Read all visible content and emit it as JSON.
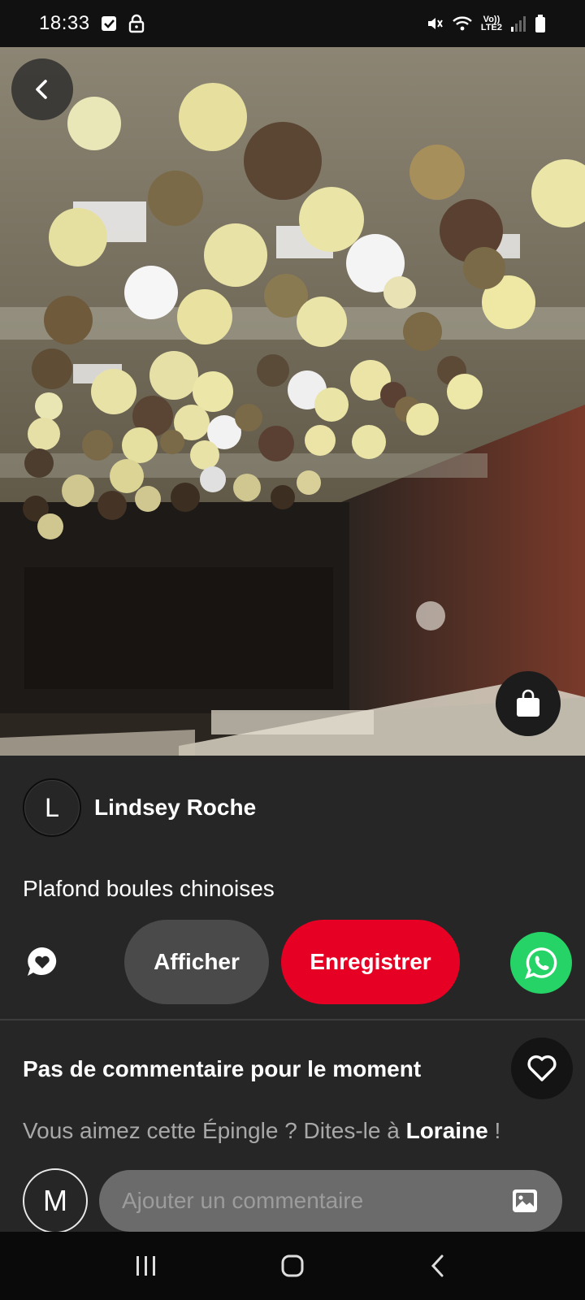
{
  "status_bar": {
    "time": "18:33",
    "network_label_top": "Vo))",
    "network_label_bottom": "LTE2",
    "icons": [
      "checkbox-icon",
      "lock-icon",
      "mute-icon",
      "wifi-icon",
      "signal-icon",
      "battery-icon"
    ]
  },
  "hero": {
    "icons": {
      "back": "chevron-left-icon",
      "shop": "shopping-bag-icon"
    }
  },
  "author": {
    "initial": "L",
    "name": "Lindsey Roche"
  },
  "pin": {
    "title": "Plafond boules chinoises"
  },
  "actions": {
    "view_label": "Afficher",
    "save_label": "Enregistrer",
    "save_color": "#e60023",
    "whatsapp_color": "#25d366",
    "icons": [
      "comment-heart-icon",
      "whatsapp-icon"
    ]
  },
  "comments": {
    "empty_title": "Pas de commentaire pour le moment",
    "like_prompt_prefix": "Vous aimez cette Épingle ? Dites-le à ",
    "like_prompt_owner": "Loraine",
    "like_prompt_suffix": " !",
    "my_initial": "M",
    "input_placeholder": "Ajouter un commentaire",
    "icons": [
      "heart-icon",
      "image-icon"
    ]
  },
  "nav": {
    "icons": [
      "recents-icon",
      "home-icon",
      "back-icon"
    ]
  }
}
